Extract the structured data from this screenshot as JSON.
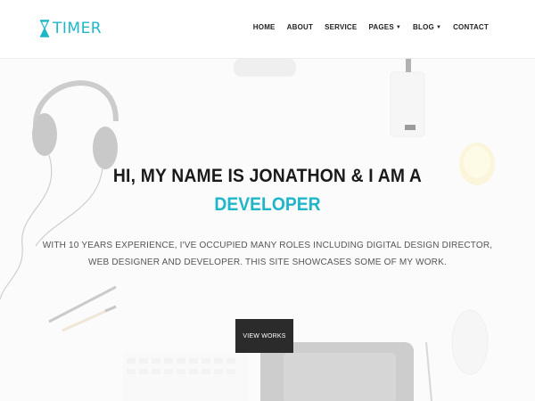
{
  "brand": {
    "name": "TIMER",
    "color": "#1fb6c9"
  },
  "nav": {
    "items": [
      {
        "label": "HOME",
        "dropdown": false
      },
      {
        "label": "ABOUT",
        "dropdown": false
      },
      {
        "label": "SERVICE",
        "dropdown": false
      },
      {
        "label": "PAGES",
        "dropdown": true
      },
      {
        "label": "BLOG",
        "dropdown": true
      },
      {
        "label": "CONTACT",
        "dropdown": false
      }
    ]
  },
  "hero": {
    "headline": "HI, MY NAME IS JONATHON & I AM A",
    "highlight": "DEVELOPER",
    "description_line1": "WITH 10 YEARS EXPERIENCE, I'VE OCCUPIED MANY ROLES INCLUDING DIGITAL DESIGN DIRECTOR,",
    "description_line2": "WEB DESIGNER AND DEVELOPER. THIS SITE SHOWCASES SOME OF MY WORK.",
    "button_label": "VIEW WORKS"
  },
  "icons": {
    "logo": "hourglass-icon",
    "caret": "caret-down-icon"
  }
}
